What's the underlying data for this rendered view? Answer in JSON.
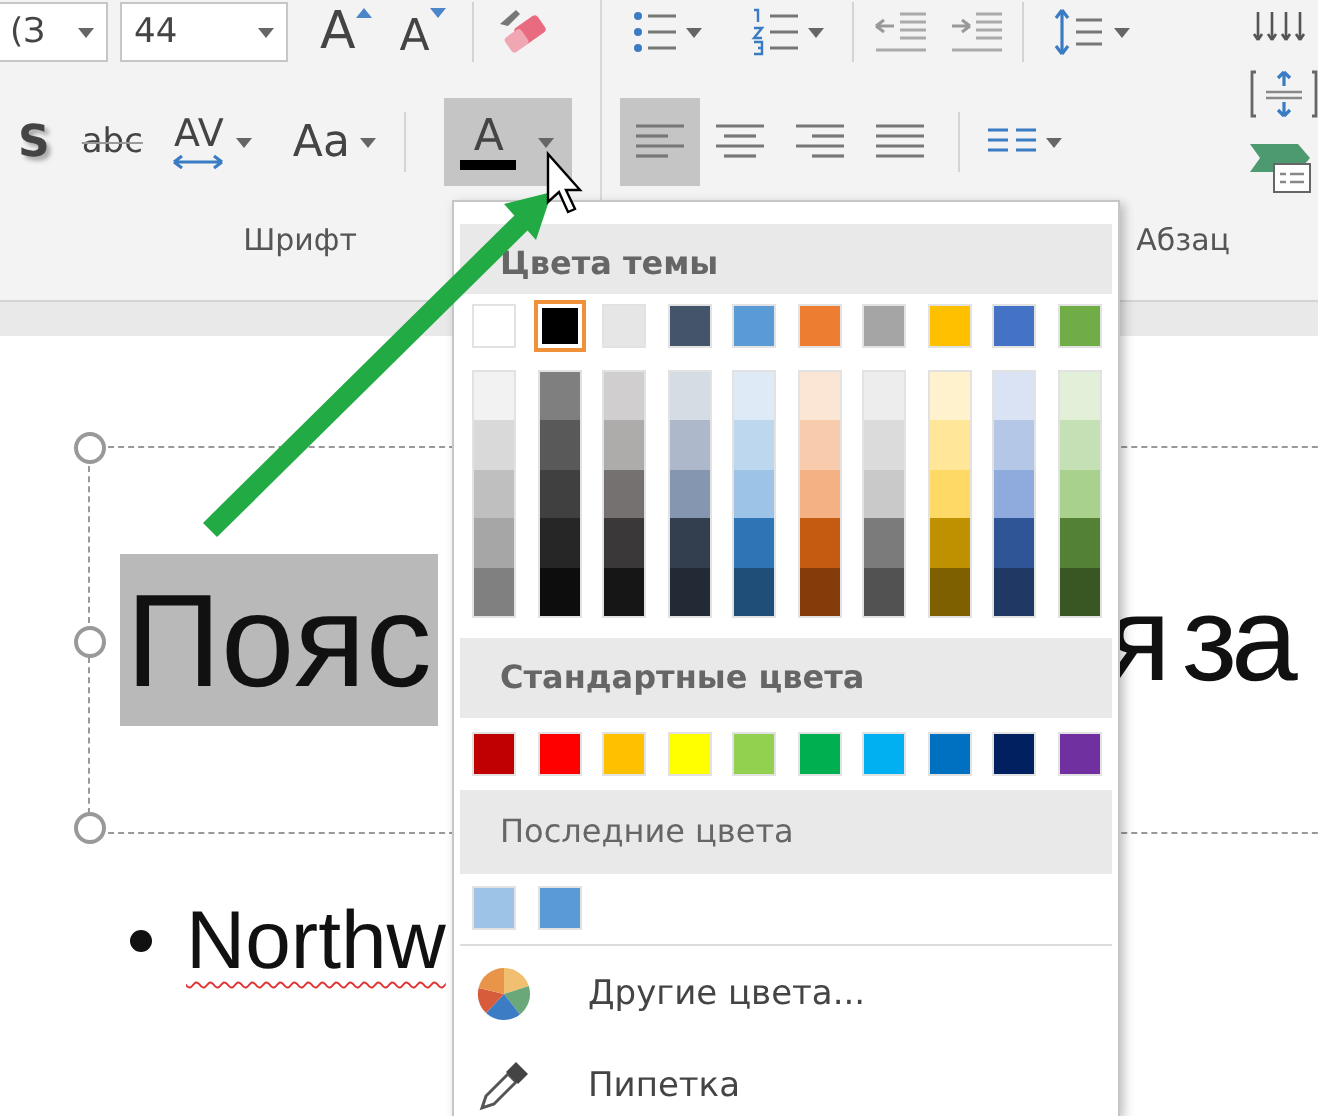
{
  "ribbon": {
    "font_group": {
      "font_name": {
        "value": "(З"
      },
      "font_size": {
        "value": "44"
      },
      "size_buttons": [
        {
          "kind": "grow",
          "label": "A"
        },
        {
          "kind": "shrink",
          "label": "A"
        }
      ],
      "buttons": [
        {
          "kind": "shadow",
          "label": "S",
          "selected": false
        },
        {
          "kind": "strikethrough",
          "label": "abc",
          "selected": false
        },
        {
          "kind": "spacing",
          "label": "AV",
          "selected": false
        },
        {
          "kind": "case",
          "label": "Aa",
          "selected": false
        },
        {
          "kind": "font_color",
          "label": "A",
          "selected": true
        }
      ],
      "label": "Шрифт"
    },
    "paragraph_group": {
      "alignment": [
        {
          "kind": "left",
          "selected": true
        },
        {
          "kind": "center",
          "selected": false
        },
        {
          "kind": "right",
          "selected": false
        },
        {
          "kind": "justify",
          "selected": false
        }
      ],
      "label": "Абзац"
    }
  },
  "slide": {
    "title_parts": [
      {
        "text": "Пояс",
        "highlighted": true
      },
      {
        "text": "я за",
        "highlighted": false
      }
    ],
    "bullets": [
      {
        "text": "Northw",
        "misspelled": true
      }
    ]
  },
  "color_menu": {
    "theme_header": "Цвета темы",
    "theme_colors": [
      {
        "color": "#ffffff",
        "selected": false,
        "shades": [
          {
            "color": "#f2f2f2"
          },
          {
            "color": "#d9d9d9"
          },
          {
            "color": "#bfbfbf"
          },
          {
            "color": "#a6a6a6"
          },
          {
            "color": "#808080"
          }
        ]
      },
      {
        "color": "#000000",
        "selected": true,
        "shades": [
          {
            "color": "#7f7f7f"
          },
          {
            "color": "#595959"
          },
          {
            "color": "#404040"
          },
          {
            "color": "#262626"
          },
          {
            "color": "#0d0d0d"
          }
        ]
      },
      {
        "color": "#e7e6e6",
        "selected": false,
        "shades": [
          {
            "color": "#d0cece"
          },
          {
            "color": "#aeabab"
          },
          {
            "color": "#757171"
          },
          {
            "color": "#3a3838"
          },
          {
            "color": "#161616"
          }
        ]
      },
      {
        "color": "#44546a",
        "selected": false,
        "shades": [
          {
            "color": "#d6dce4"
          },
          {
            "color": "#adb9ca"
          },
          {
            "color": "#8496b0"
          },
          {
            "color": "#333f4f"
          },
          {
            "color": "#222a35"
          }
        ]
      },
      {
        "color": "#5b9bd5",
        "selected": false,
        "shades": [
          {
            "color": "#deebf6"
          },
          {
            "color": "#bdd7ee"
          },
          {
            "color": "#9dc3e6"
          },
          {
            "color": "#2e75b5"
          },
          {
            "color": "#1f4e79"
          }
        ]
      },
      {
        "color": "#ed7d31",
        "selected": false,
        "shades": [
          {
            "color": "#fbe5d5"
          },
          {
            "color": "#f8cbad"
          },
          {
            "color": "#f4b183"
          },
          {
            "color": "#c55a11"
          },
          {
            "color": "#843c0b"
          }
        ]
      },
      {
        "color": "#a5a5a5",
        "selected": false,
        "shades": [
          {
            "color": "#ededed"
          },
          {
            "color": "#dbdbdb"
          },
          {
            "color": "#c9c9c9"
          },
          {
            "color": "#7b7b7b"
          },
          {
            "color": "#525252"
          }
        ]
      },
      {
        "color": "#ffc000",
        "selected": false,
        "shades": [
          {
            "color": "#fff2cc"
          },
          {
            "color": "#ffe699"
          },
          {
            "color": "#ffd966"
          },
          {
            "color": "#bf9000"
          },
          {
            "color": "#7f6000"
          }
        ]
      },
      {
        "color": "#4472c4",
        "selected": false,
        "shades": [
          {
            "color": "#dae3f3"
          },
          {
            "color": "#b4c7e7"
          },
          {
            "color": "#8faadc"
          },
          {
            "color": "#2f5597"
          },
          {
            "color": "#203864"
          }
        ]
      },
      {
        "color": "#70ad47",
        "selected": false,
        "shades": [
          {
            "color": "#e2f0d9"
          },
          {
            "color": "#c5e0b4"
          },
          {
            "color": "#a9d18e"
          },
          {
            "color": "#538135"
          },
          {
            "color": "#385723"
          }
        ]
      }
    ],
    "standard_header": "Стандартные цвета",
    "standard_colors": [
      {
        "color": "#c00000"
      },
      {
        "color": "#ff0000"
      },
      {
        "color": "#ffc000"
      },
      {
        "color": "#ffff00"
      },
      {
        "color": "#92d050"
      },
      {
        "color": "#00b050"
      },
      {
        "color": "#00b0f0"
      },
      {
        "color": "#0070c0"
      },
      {
        "color": "#002060"
      },
      {
        "color": "#7030a0"
      }
    ],
    "recent_header": "Последние цвета",
    "recent_colors": [
      {
        "color": "#9dc3e6"
      },
      {
        "color": "#5b9bd5"
      }
    ],
    "items": [
      {
        "kind": "more_colors",
        "label": "Другие цвета..."
      },
      {
        "kind": "eyedropper",
        "label": "Пипетка"
      }
    ]
  }
}
